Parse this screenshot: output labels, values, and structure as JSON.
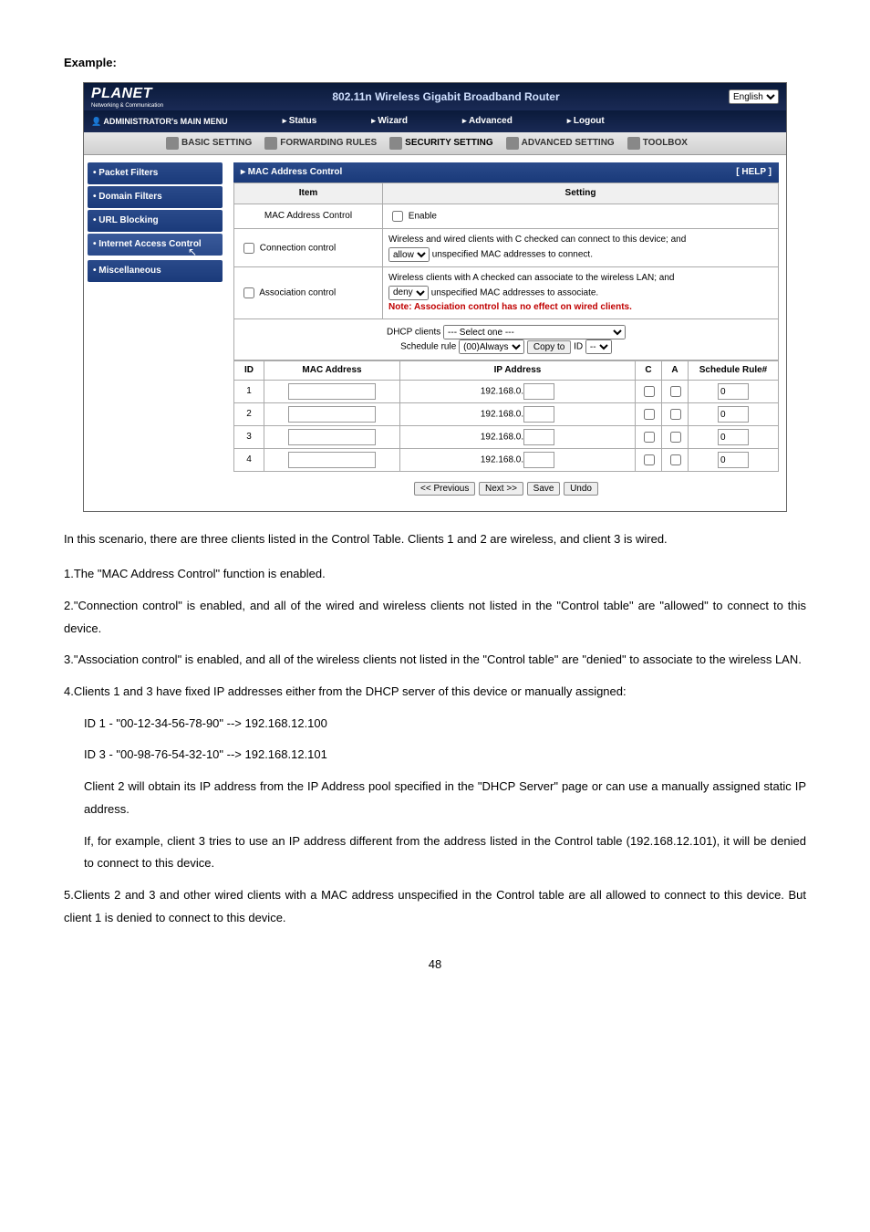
{
  "heading": "Example:",
  "router": {
    "logo": "PLANET",
    "logo_sub": "Networking & Communication",
    "title": "802.11n Wireless Gigabit Broadband Router",
    "lang": "English",
    "mainmenu": {
      "label": "ADMINISTRATOR's MAIN MENU",
      "items": [
        "Status",
        "Wizard",
        "Advanced",
        "Logout"
      ]
    },
    "tabs": [
      "BASIC SETTING",
      "FORWARDING RULES",
      "SECURITY SETTING",
      "ADVANCED SETTING",
      "TOOLBOX"
    ],
    "sidebar": [
      "Packet Filters",
      "Domain Filters",
      "URL Blocking",
      "Internet Access Control",
      "Miscellaneous"
    ],
    "panel_title": "▸ MAC Address Control",
    "help": "[ HELP ]",
    "th_item": "Item",
    "th_setting": "Setting",
    "row_mac": "MAC Address Control",
    "row_mac_enable": "Enable",
    "row_conn": "Connection control",
    "row_conn_text1": "Wireless and wired clients with C checked can connect to this device; and",
    "row_conn_sel": "allow",
    "row_conn_text2": "unspecified MAC addresses to connect.",
    "row_assoc": "Association control",
    "row_assoc_text1": "Wireless clients with A checked can associate to the wireless LAN; and",
    "row_assoc_sel": "deny",
    "row_assoc_text2": "unspecified MAC addresses to associate.",
    "row_assoc_note": "Note: Association control has no effect on wired clients.",
    "dhcp_label": "DHCP clients",
    "dhcp_sel": "--- Select one ---",
    "sched_label": "Schedule rule",
    "sched_sel": "(00)Always",
    "copy_btn": "Copy to",
    "copy_id_label": "ID",
    "copy_id_sel": "--",
    "dt": {
      "id": "ID",
      "mac": "MAC Address",
      "ip": "IP Address",
      "c": "C",
      "a": "A",
      "sr": "Schedule Rule#"
    },
    "ip_prefix": "192.168.0.",
    "rows": [
      {
        "id": "1",
        "sr": "0"
      },
      {
        "id": "2",
        "sr": "0"
      },
      {
        "id": "3",
        "sr": "0"
      },
      {
        "id": "4",
        "sr": "0"
      }
    ],
    "buttons": {
      "prev": "<< Previous",
      "next": "Next >>",
      "save": "Save",
      "undo": "Undo"
    }
  },
  "para_intro": "In this scenario, there are three clients listed in the Control Table. Clients 1 and 2 are wireless, and client 3 is wired.",
  "list": {
    "i1": "1.The \"MAC Address Control\" function is enabled.",
    "i2": "2.\"Connection control\" is enabled, and all of the wired and wireless clients not listed in the \"Control table\" are \"allowed\" to connect to this device.",
    "i3": "3.\"Association control\" is enabled, and all of the wireless clients not listed in the \"Control table\" are \"denied\" to associate to the wireless LAN.",
    "i4": "4.Clients 1 and 3 have fixed IP addresses either from the DHCP server of this device or manually assigned:",
    "i4a": "ID 1 - \"00-12-34-56-78-90\" --> 192.168.12.100",
    "i4b": "ID 3 - \"00-98-76-54-32-10\" --> 192.168.12.101",
    "i4c": "Client 2 will obtain its IP address from the IP Address pool specified in the \"DHCP Server\" page or can use a manually assigned static IP address.",
    "i4d": "If, for example, client 3 tries to use an IP address different from the address listed in the Control table (192.168.12.101), it will be denied to connect to this device.",
    "i5": "5.Clients 2 and 3 and other wired clients with a MAC address unspecified in the Control table are all allowed to connect to this device. But client 1 is denied to connect to this device."
  },
  "pagenum": "48"
}
